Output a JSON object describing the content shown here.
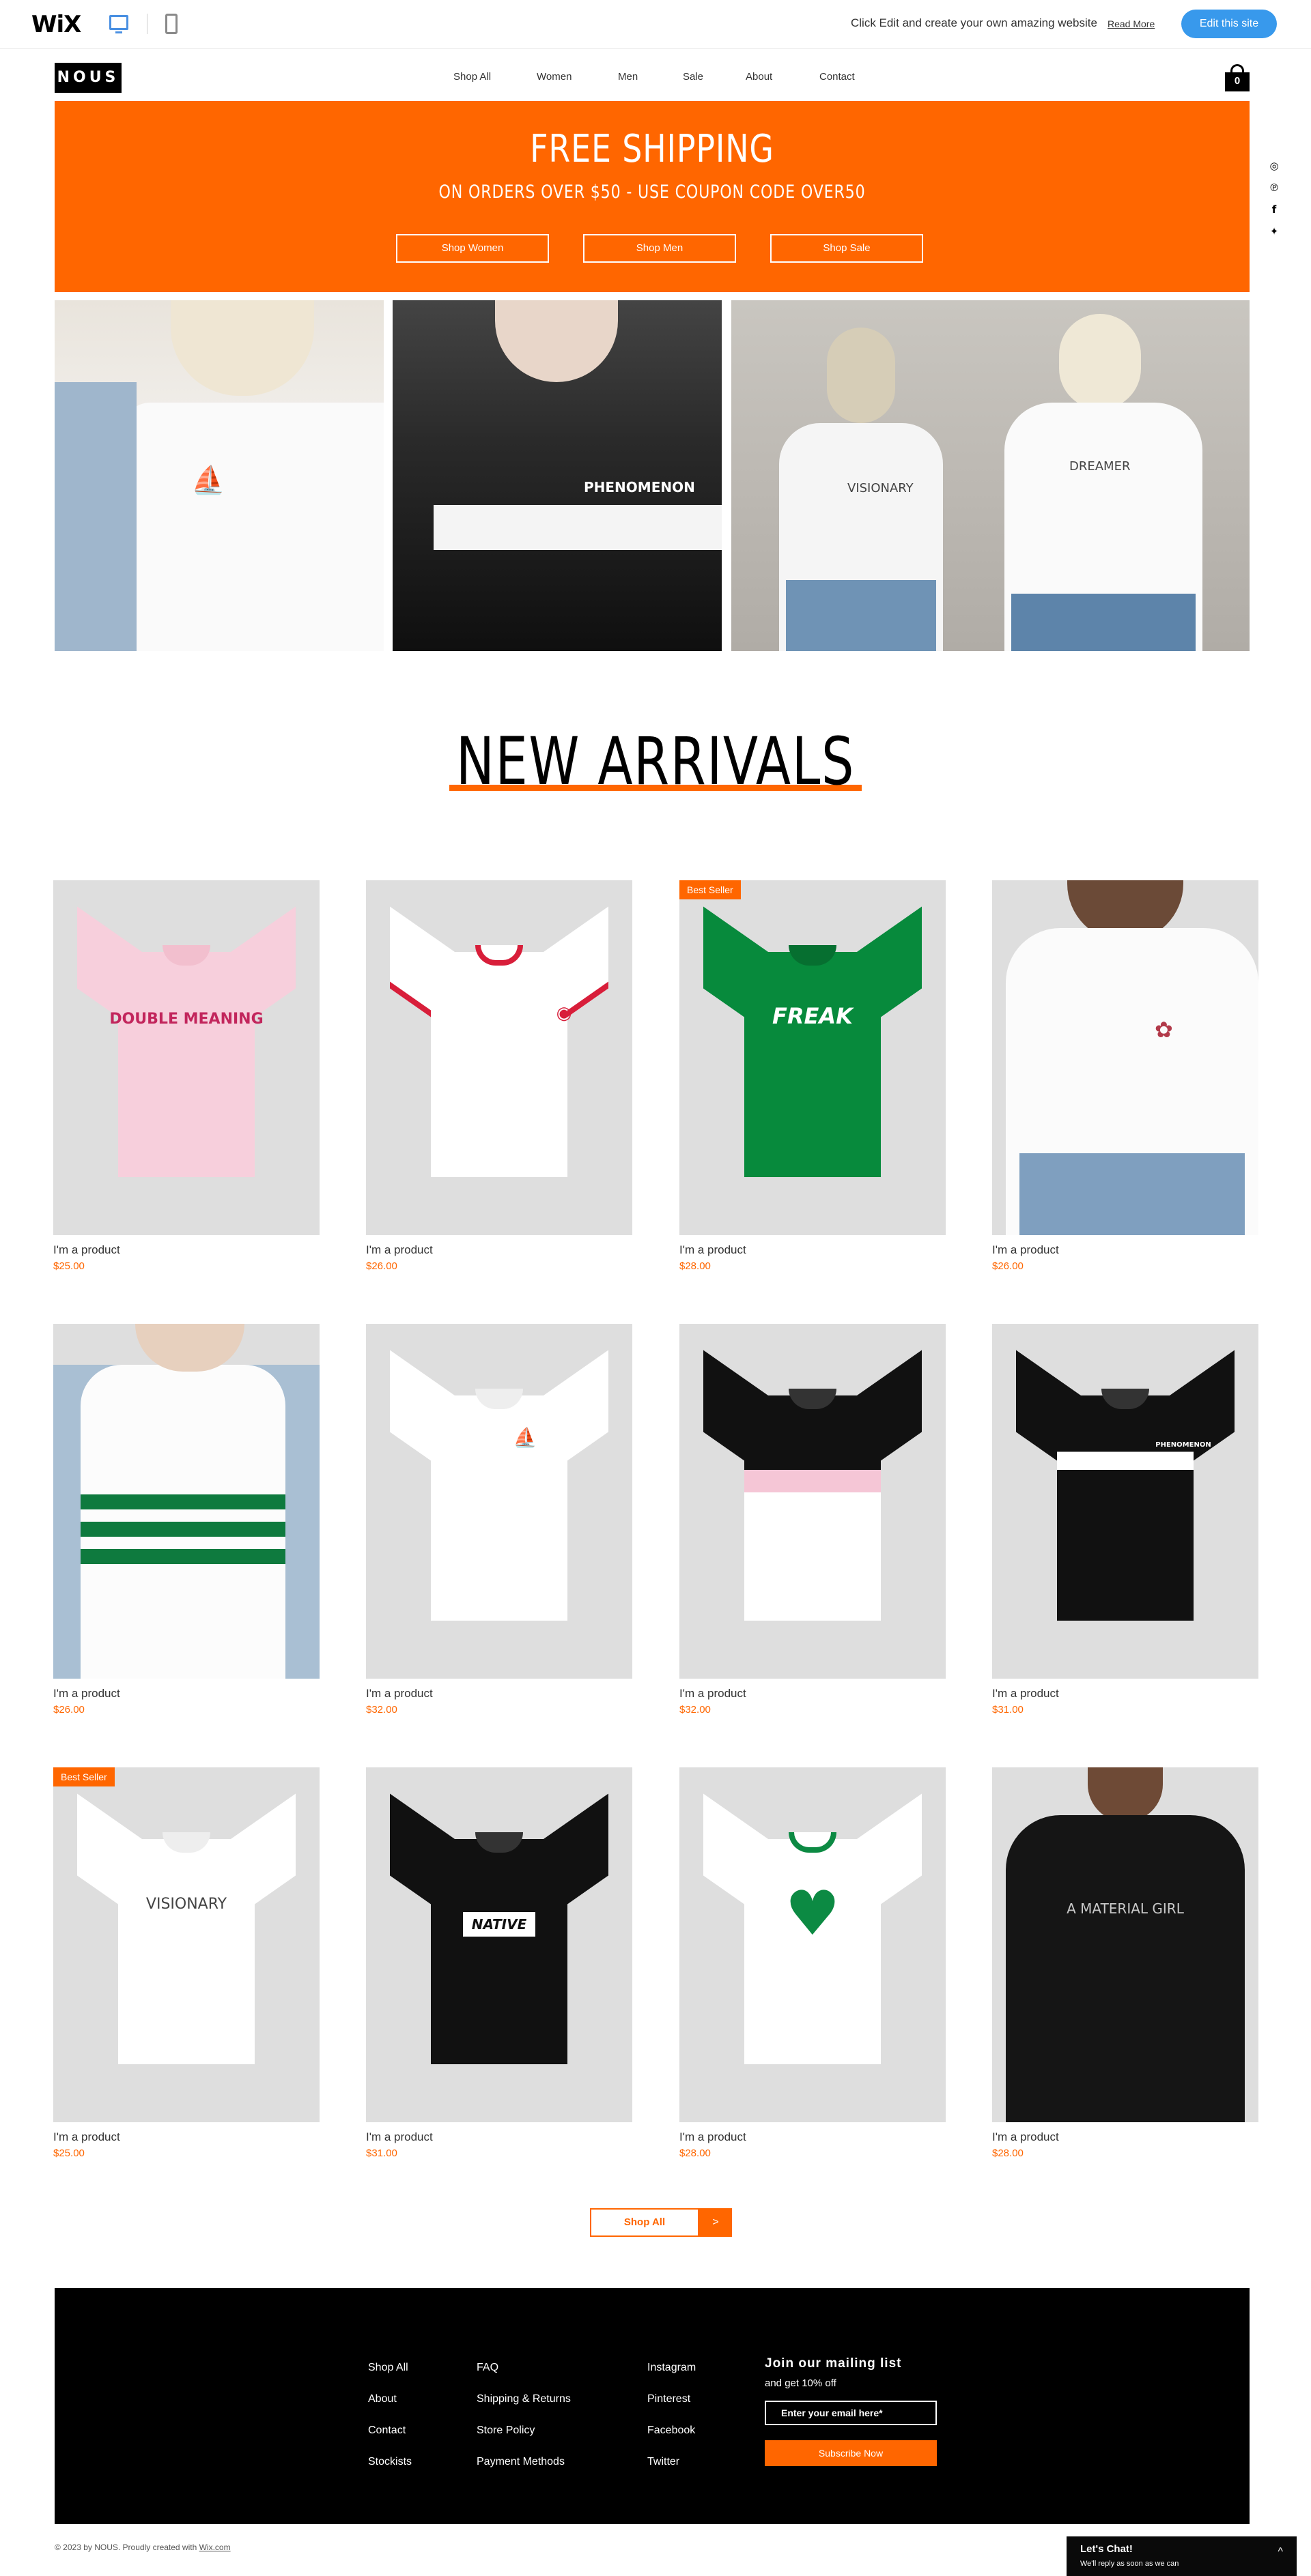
{
  "wixbar": {
    "logo": "WiX",
    "prompt": "Click Edit and create your own amazing website",
    "read_more": "Read More",
    "edit_button": "Edit this site"
  },
  "header": {
    "logo": "NOUS",
    "nav": [
      "Shop All",
      "Women",
      "Men",
      "Sale",
      "About",
      "Contact"
    ],
    "cart_count": "0"
  },
  "social": [
    "instagram-icon",
    "pinterest-icon",
    "facebook-icon",
    "twitter-icon"
  ],
  "banner": {
    "title": "FREE SHIPPING",
    "subtitle": "ON ORDERS OVER $50 - USE COUPON CODE OVER50",
    "buttons": [
      "Shop Women",
      "Shop Men",
      "Shop Sale"
    ],
    "color": "#ff6600"
  },
  "hero": {
    "shirt_2_text": "PHENOMENON",
    "shirt_3a_text": "VISIONARY",
    "shirt_3b_text": "DREAMER"
  },
  "arrivals": {
    "title": "NEW ARRIVALS",
    "products": [
      {
        "name": "I'm a product",
        "price": "$25.00",
        "badge": "",
        "print": "DOUBLE MEANING"
      },
      {
        "name": "I'm a product",
        "price": "$26.00",
        "badge": "",
        "print": ""
      },
      {
        "name": "I'm a product",
        "price": "$28.00",
        "badge": "Best Seller",
        "print": "FREAK"
      },
      {
        "name": "I'm a product",
        "price": "$26.00",
        "badge": "",
        "print": ""
      },
      {
        "name": "I'm a product",
        "price": "$26.00",
        "badge": "",
        "print": ""
      },
      {
        "name": "I'm a product",
        "price": "$32.00",
        "badge": "",
        "print": ""
      },
      {
        "name": "I'm a product",
        "price": "$32.00",
        "badge": "",
        "print": ""
      },
      {
        "name": "I'm a product",
        "price": "$31.00",
        "badge": "",
        "print": "PHENOMENON"
      },
      {
        "name": "I'm a product",
        "price": "$25.00",
        "badge": "Best Seller",
        "print": "VISIONARY"
      },
      {
        "name": "I'm a product",
        "price": "$31.00",
        "badge": "",
        "print": "NATIVE"
      },
      {
        "name": "I'm a product",
        "price": "$28.00",
        "badge": "",
        "print": ""
      },
      {
        "name": "I'm a product",
        "price": "$28.00",
        "badge": "",
        "print": "A MATERIAL GIRL"
      }
    ],
    "shop_all": "Shop All",
    "shop_all_arrow": ">"
  },
  "footer": {
    "col1": [
      "Shop All",
      "About",
      "Contact",
      "Stockists"
    ],
    "col2": [
      "FAQ",
      "Shipping & Returns",
      "Store Policy",
      "Payment Methods"
    ],
    "col3": [
      "Instagram",
      "Pinterest",
      "Facebook",
      "Twitter"
    ],
    "mailing_title": "Join our mailing list",
    "mailing_sub": "and get 10% off",
    "email_placeholder": "Enter your email here*",
    "subscribe": "Subscribe Now"
  },
  "copyright": {
    "text": "© 2023 by NOUS. Proudly created with ",
    "link": "Wix.com"
  },
  "chat": {
    "title": "Let's Chat!",
    "subtitle": "We'll reply as soon as we can",
    "arrow": "^"
  }
}
